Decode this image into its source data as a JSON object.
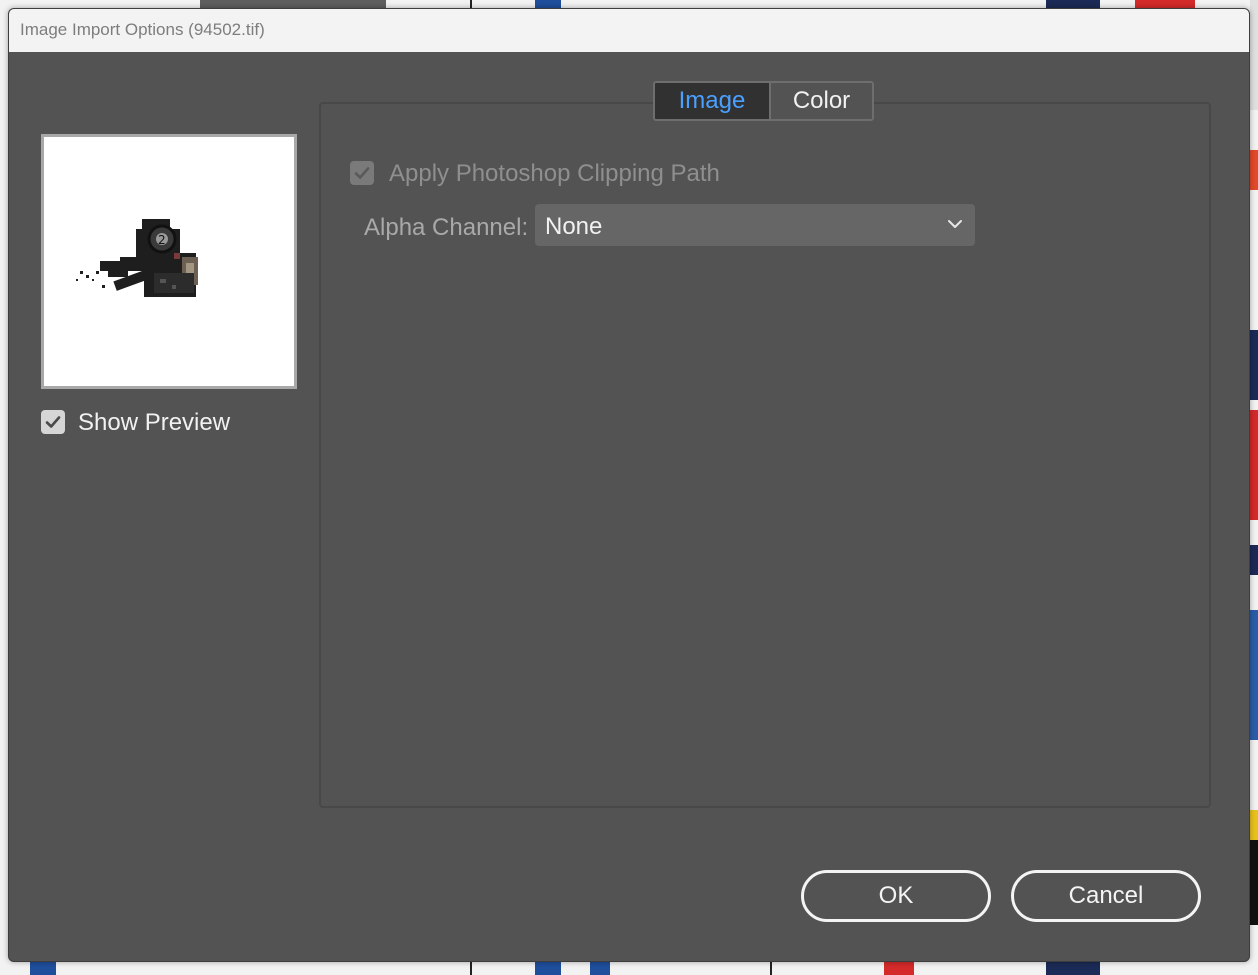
{
  "dialog": {
    "title": "Image Import Options (94502.tif)",
    "show_preview_label": "Show Preview",
    "show_preview_checked": true
  },
  "tabs": [
    {
      "label": "Image",
      "active": true
    },
    {
      "label": "Color",
      "active": false
    }
  ],
  "image_tab": {
    "clipping_path_label": "Apply Photoshop Clipping Path",
    "clipping_path_checked": true,
    "clipping_path_enabled": false,
    "alpha_channel_label": "Alpha Channel:",
    "alpha_channel_value": "None"
  },
  "buttons": {
    "ok": "OK",
    "cancel": "Cancel"
  },
  "colors": {
    "dialog_bg": "#535353",
    "active_tab_text": "#4ba0ff",
    "active_tab_bg": "#313131"
  },
  "icons": [
    "checkmark-icon",
    "chevron-down-icon",
    "image-thumbnail"
  ]
}
